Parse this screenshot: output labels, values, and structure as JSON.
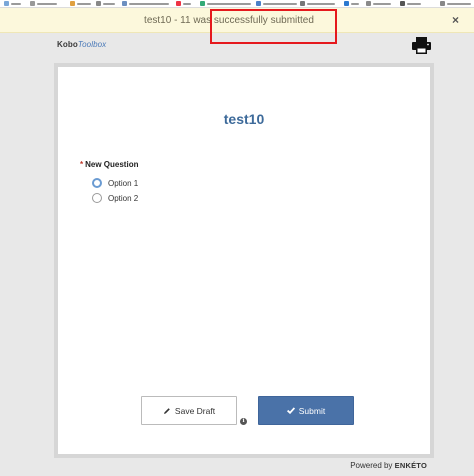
{
  "banner": {
    "message": "test10 - 11 was successfully submitted",
    "close_label": "×"
  },
  "header": {
    "logo_part1": "Kobo",
    "logo_part2": "Toolbox"
  },
  "form": {
    "title": "test10",
    "question": {
      "required_marker": "*",
      "label": "New Question",
      "options": [
        "Option 1",
        "Option 2"
      ]
    },
    "save_draft_label": "Save Draft",
    "submit_label": "Submit",
    "info_symbol": "i"
  },
  "footer": {
    "powered_by": "Powered by",
    "brand": "ENKÉTO"
  },
  "colors": {
    "banner_bg": "#fcf8dc",
    "accent": "#4a72a8",
    "title": "#3d6a9a",
    "highlight": "#e5191d"
  }
}
